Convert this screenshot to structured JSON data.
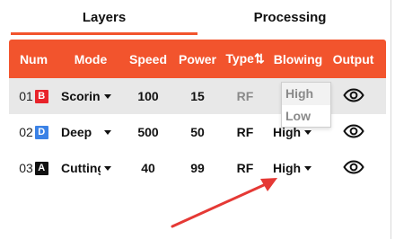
{
  "tabs": [
    {
      "label": "Layers",
      "active": true
    },
    {
      "label": "Processing",
      "active": false
    }
  ],
  "colors": {
    "accent": "#f2542d",
    "row_selected": "#e8e8e8",
    "muted_text": "#8a8a8a"
  },
  "table": {
    "headers": {
      "num": "Num",
      "mode": "Mode",
      "speed": "Speed",
      "power": "Power",
      "type": "Type⇅",
      "blowing": "Blowing",
      "output": "Output"
    },
    "rows": [
      {
        "num": "01",
        "badge": "B",
        "badge_color": "#e8232a",
        "mode": "Scoring",
        "speed": "100",
        "power": "15",
        "type": "RF",
        "blowing": "High",
        "output_icon": "eye-icon"
      },
      {
        "num": "02",
        "badge": "D",
        "badge_color": "#3b82e6",
        "mode": "Deep",
        "speed": "500",
        "power": "50",
        "type": "RF",
        "blowing": "High",
        "output_icon": "eye-icon"
      },
      {
        "num": "03",
        "badge": "A",
        "badge_color": "#111111",
        "mode": "Cutting",
        "speed": "40",
        "power": "99",
        "type": "RF",
        "blowing": "High",
        "output_icon": "eye-icon"
      }
    ]
  },
  "blowing_dropdown": {
    "options": [
      "High",
      "Low"
    ]
  },
  "annotation": {
    "arrow_color": "#e53935"
  }
}
